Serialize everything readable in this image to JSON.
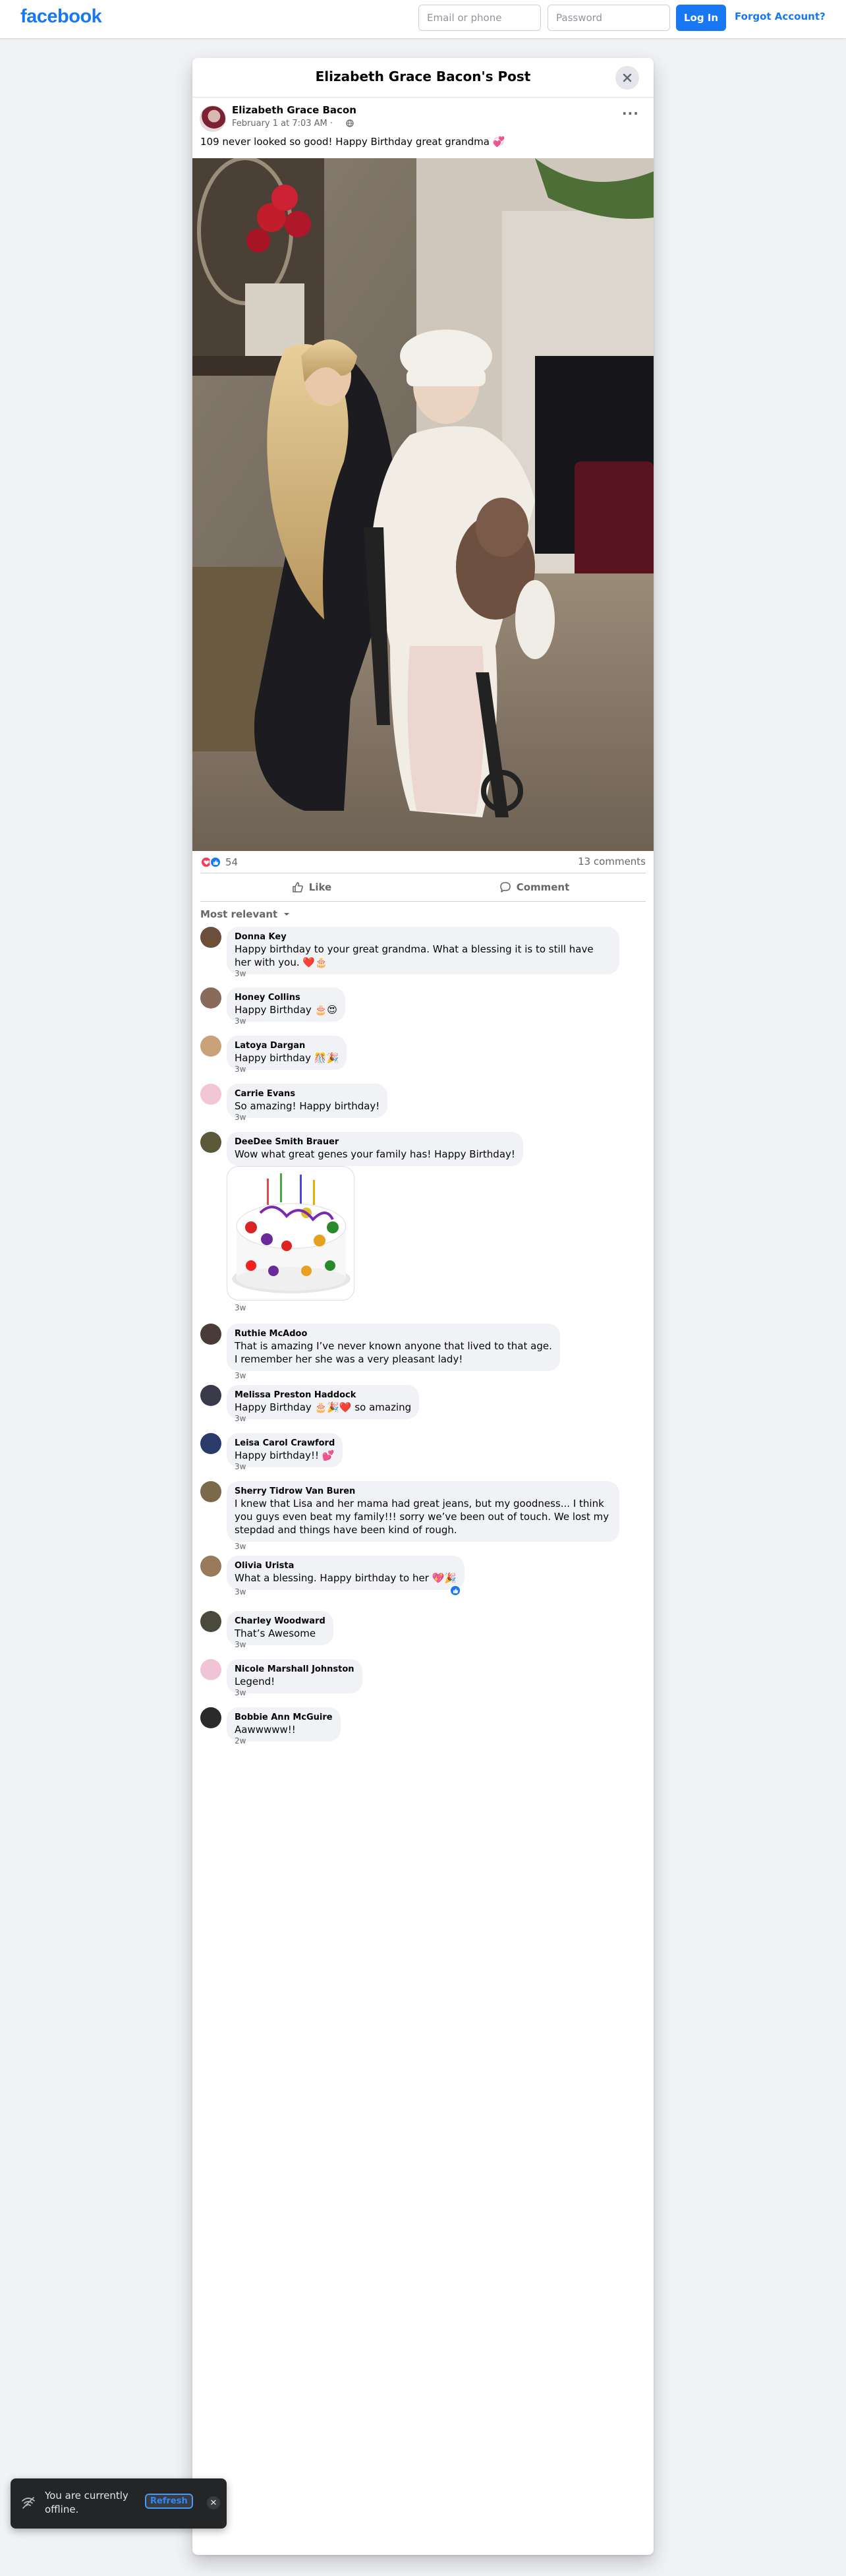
{
  "header": {
    "logo": "facebook",
    "email_placeholder": "Email or phone",
    "password_placeholder": "Password",
    "login_label": "Log In",
    "forgot_label": "Forgot Account?"
  },
  "post": {
    "modal_title": "Elizabeth Grace Bacon's Post",
    "author": "Elizabeth Grace Bacon",
    "time": "February 1 at 7:03 AM ·",
    "text": "109 never looked so good! Happy Birthday great grandma 💞",
    "reaction_count": "54",
    "comment_count": "13 comments",
    "like_label": "Like",
    "comment_label": "Comment",
    "sort_label": "Most relevant"
  },
  "comments": [
    {
      "name": "Donna Key",
      "text": "Happy birthday to your great grandma. What a blessing it is to still have her with you. ❤️🎂",
      "time": "3w",
      "avatar_color": "#6b4f3a"
    },
    {
      "name": "Honey Collins",
      "text": "Happy Birthday 🎂😍",
      "time": "3w",
      "avatar_color": "#8a6a5a"
    },
    {
      "name": "Latoya Dargan",
      "text": "Happy birthday 🎊🎉",
      "time": "3w",
      "avatar_color": "#c9a27a"
    },
    {
      "name": "Carrie Evans",
      "text": "So amazing! Happy birthday!",
      "time": "3w",
      "avatar_color": "#f3c6d6"
    },
    {
      "name": "DeeDee Smith Brauer",
      "text": "Wow what great genes your family has! Happy Birthday!",
      "time": "3w",
      "avatar_color": "#5a5a3a"
    },
    {
      "name": "Ruthie McAdoo",
      "text": "That is amazing I’ve never known anyone that lived to that age. I remember her she was a very pleasant lady!",
      "time": "3w",
      "avatar_color": "#4a3a3a"
    },
    {
      "name": "Melissa Preston Haddock",
      "text": "Happy Birthday 🎂🎉❤️ so amazing",
      "time": "3w",
      "avatar_color": "#3a3a4a"
    },
    {
      "name": "Leisa Carol Crawford",
      "text": "Happy birthday!! 💕",
      "time": "3w",
      "avatar_color": "#2a3a6a"
    },
    {
      "name": "Sherry Tidrow Van Buren",
      "text": "I knew that Lisa and her mama had great jeans, but my goodness... I think you guys even beat my family!!! sorry we’ve been out of touch. We lost my stepdad and things have been kind of rough.",
      "time": "3w",
      "avatar_color": "#7a6a4a"
    },
    {
      "name": "Olivia Urista",
      "text": "What a blessing. Happy birthday to her 💖🎉",
      "time": "3w",
      "avatar_color": "#9a7a5a"
    },
    {
      "name": "Charley Woodward",
      "text": "That’s Awesome",
      "time": "3w",
      "avatar_color": "#4a4a3a"
    },
    {
      "name": "Nicole Marshall Johnston",
      "text": "Legend!",
      "time": "3w",
      "avatar_color": "#f0c4d4"
    },
    {
      "name": "Bobbie Ann McGuire",
      "text": "Aawwwww!!",
      "time": "2w",
      "avatar_color": "#2a2a2a"
    }
  ],
  "toast": {
    "message": "You are currently offline.",
    "refresh_label": "Refresh"
  }
}
